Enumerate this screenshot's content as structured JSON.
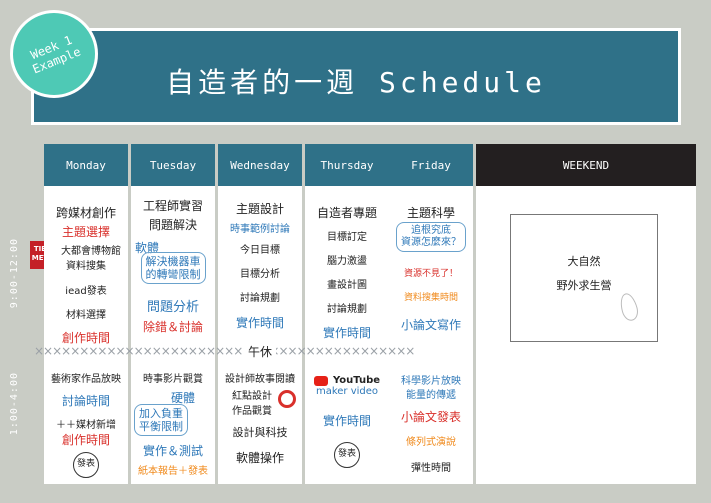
{
  "title": "自造者的一週 Schedule",
  "badge": {
    "line1": "Week 1",
    "line2": "Example"
  },
  "side": {
    "morning": "9:00-12:00",
    "afternoon": "1:00-4:00"
  },
  "tiemet_logo": "TIE MET",
  "divider": "××××××××××××××××××××××××××××××××××××××××××",
  "lunch": "午休",
  "days": {
    "monday": {
      "label": "Monday",
      "am": [
        "跨媒材創作",
        "主題選擇",
        "大都會博物館",
        "資料搜集",
        "iead發表",
        "材料選擇",
        "創作時間"
      ],
      "pm": [
        "藝術家作品放映",
        "討論時間",
        "＋＋媒材新增",
        "創作時間",
        "發表"
      ]
    },
    "tuesday": {
      "label": "Tuesday",
      "am": [
        "工程師實習",
        "問題解決",
        "軟體",
        "解決機器車",
        "的轉彎限制",
        "問題分析",
        "除錯＆討論"
      ],
      "pm": [
        "時事影片觀賞",
        "硬體",
        "加入負重",
        "平衡限制",
        "實作＆測試",
        "紙本報告＋發表"
      ]
    },
    "wednesday": {
      "label": "Wednesday",
      "am": [
        "主題設計",
        "時事範例討論",
        "今日目標",
        "目標分析",
        "討論規劃",
        "實作時間"
      ],
      "pm": [
        "設計師故事閱讀",
        "紅點設計",
        "作品觀賞",
        "設計與科技",
        "軟體操作"
      ]
    },
    "thursday": {
      "label": "Thursday",
      "am": [
        "自造者專題",
        "目標訂定",
        "腦力激盪",
        "畫設計圖",
        "討論規劃",
        "實作時間"
      ],
      "pm": [
        "YouTube",
        "maker video",
        "實作時間",
        "發表"
      ]
    },
    "friday": {
      "label": "Friday",
      "am": [
        "主題科學",
        "追根究底",
        "資源怎麼來？",
        "資源不見了！",
        "資料搜集時間",
        "小論文寫作"
      ],
      "pm": [
        "科學影片放映",
        "能量的傳遞",
        "小論文發表",
        "條列式演說",
        "彈性時間"
      ]
    },
    "weekend": {
      "label": "WEEKEND",
      "card": [
        "大自然",
        "野外求生營"
      ]
    }
  }
}
